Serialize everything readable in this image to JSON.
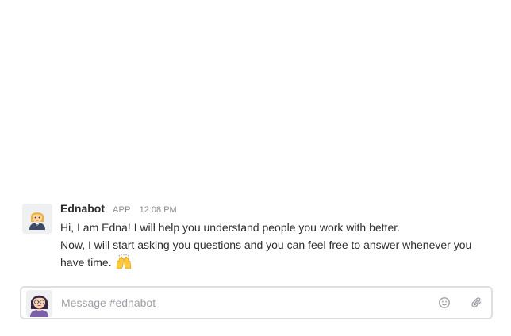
{
  "message": {
    "sender": "Ednabot",
    "badge": "APP",
    "timestamp": "12:08 PM",
    "lines": [
      "Hi, I am Edna! I will help you understand people you work with better.",
      "Now, I will start asking you questions and you can feel free to answer whenever you have time."
    ],
    "trailing_emoji": "raised-hands-emoji",
    "avatar_icon": "woman-office-worker-emoji"
  },
  "composer": {
    "placeholder": "Message #ednabot",
    "value": "",
    "emoji_button_icon": "smiley-icon",
    "attach_button_icon": "paperclip-icon",
    "user_avatar_icon": "user-avatar"
  },
  "colors": {
    "text": "#2c2d30",
    "muted": "#8b8c90",
    "placeholder": "#9e9ea6",
    "border": "#dfdfe1"
  }
}
